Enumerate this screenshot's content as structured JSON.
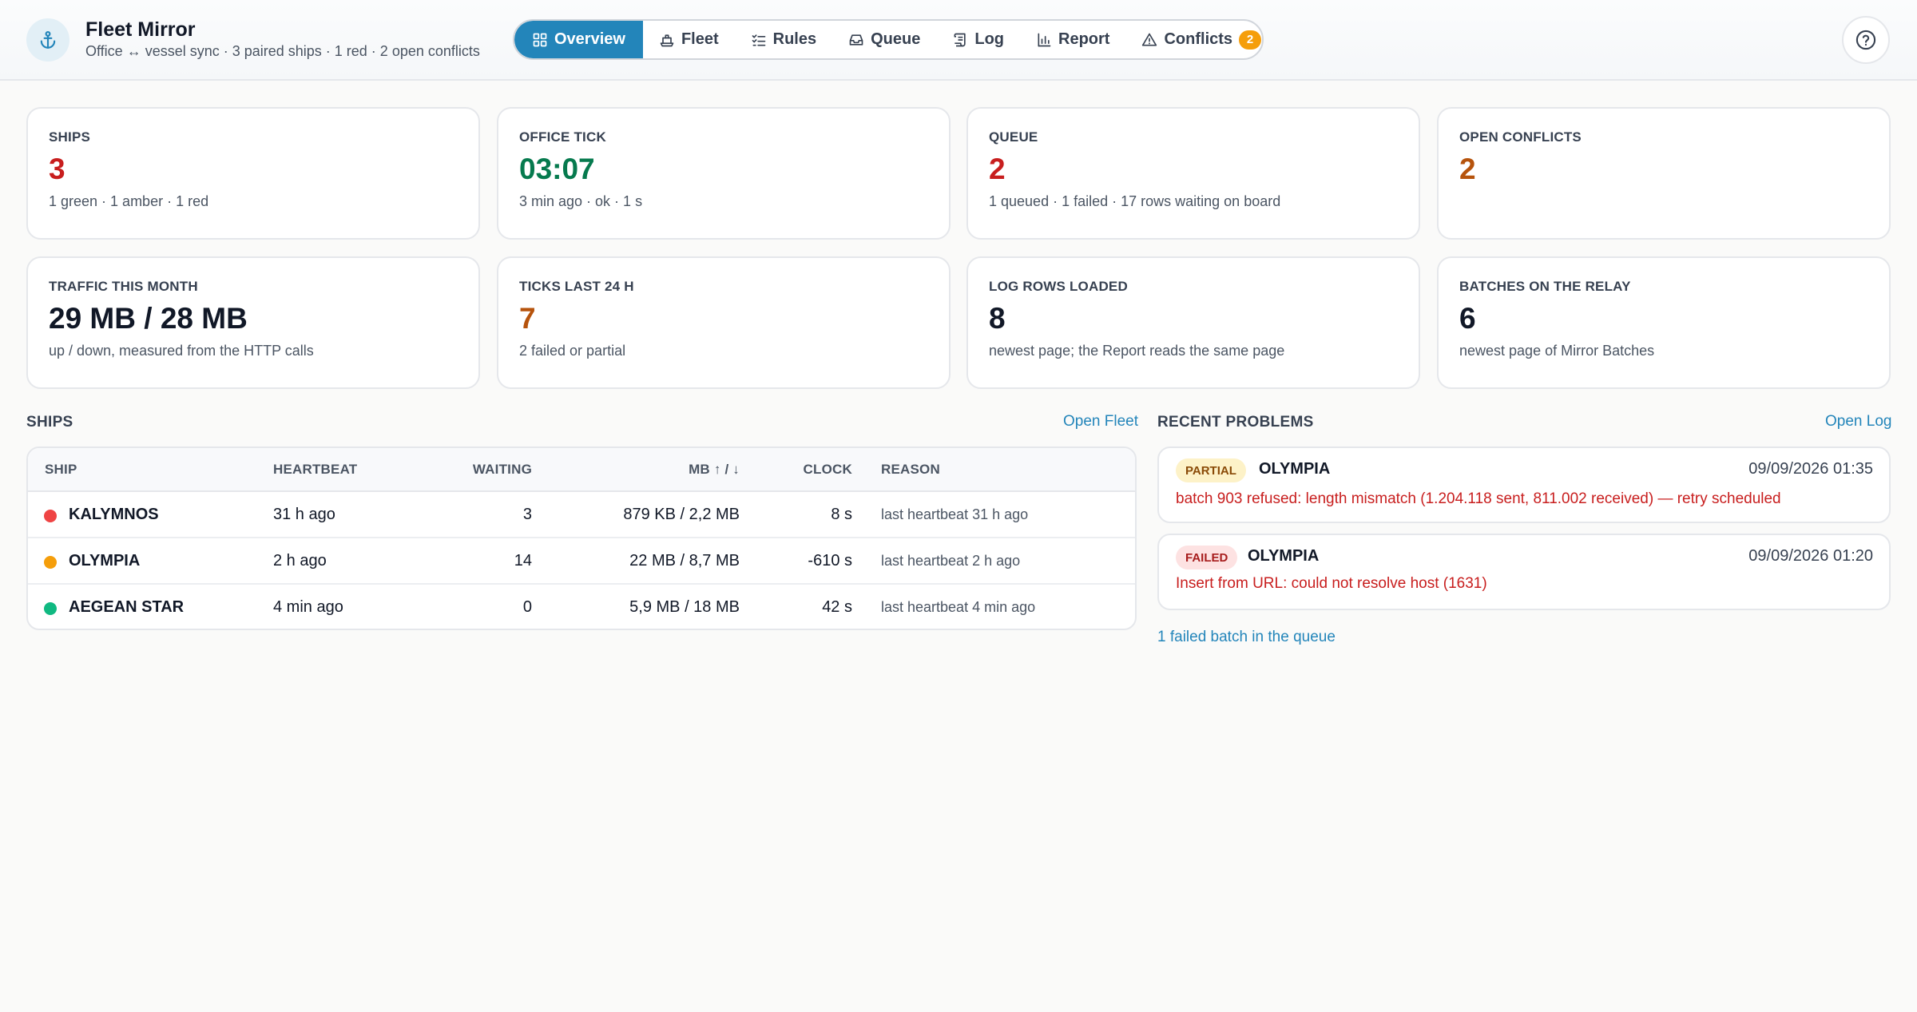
{
  "app": {
    "title": "Fleet Mirror",
    "subtitle": "Office ↔ vessel sync · 3 paired ships · 1 red · 2 open conflicts"
  },
  "tabs": [
    {
      "label": "Overview",
      "icon": "grid-icon",
      "active": true
    },
    {
      "label": "Fleet",
      "icon": "ship-icon"
    },
    {
      "label": "Rules",
      "icon": "checklist-icon"
    },
    {
      "label": "Queue",
      "icon": "inbox-icon"
    },
    {
      "label": "Log",
      "icon": "scroll-icon"
    },
    {
      "label": "Report",
      "icon": "bar-chart-icon"
    },
    {
      "label": "Conflicts",
      "icon": "warning-icon",
      "badge": "2"
    }
  ],
  "colors": {
    "accent": "#2385ba",
    "red": "#c81e1e",
    "green": "#067a4e",
    "orange": "#b6530c",
    "status_green": "#10b981",
    "status_amber": "#f59e0b",
    "status_red": "#ef4444"
  },
  "stats": [
    {
      "label": "SHIPS",
      "value": "3",
      "note": "1 green · 1 amber · 1 red",
      "tone": "red"
    },
    {
      "label": "OFFICE TICK",
      "value": "03:07",
      "note": "3 min ago · ok · 1 s",
      "tone": "green"
    },
    {
      "label": "QUEUE",
      "value": "2",
      "note": "1 queued · 1 failed · 17 rows waiting on board",
      "tone": "red"
    },
    {
      "label": "OPEN CONFLICTS",
      "value": "2",
      "note": "",
      "tone": "orange"
    },
    {
      "label": "TRAFFIC THIS MONTH",
      "value": "29 MB / 28 MB",
      "note": "up / down, measured from the HTTP calls",
      "tone": "dark"
    },
    {
      "label": "TICKS LAST 24 H",
      "value": "7",
      "note": "2 failed or partial",
      "tone": "orange"
    },
    {
      "label": "LOG ROWS LOADED",
      "value": "8",
      "note": "newest page; the Report reads the same page",
      "tone": "dark"
    },
    {
      "label": "BATCHES ON THE RELAY",
      "value": "6",
      "note": "newest page of Mirror Batches",
      "tone": "dark"
    }
  ],
  "ships_section": {
    "title": "SHIPS",
    "link": "Open Fleet",
    "columns": [
      "SHIP",
      "HEARTBEAT",
      "WAITING",
      "MB ↑ / ↓",
      "CLOCK",
      "REASON"
    ],
    "rows": [
      {
        "status": "red",
        "ship": "KALYMNOS",
        "heartbeat": "31 h ago",
        "waiting": "3",
        "mb": "879 KB / 2,2 MB",
        "clock": "8 s",
        "reason": "last heartbeat 31 h ago"
      },
      {
        "status": "amber",
        "ship": "OLYMPIA",
        "heartbeat": "2 h ago",
        "waiting": "14",
        "mb": "22 MB / 8,7 MB",
        "clock": "-610 s",
        "reason": "last heartbeat 2 h ago"
      },
      {
        "status": "green",
        "ship": "AEGEAN STAR",
        "heartbeat": "4 min ago",
        "waiting": "0",
        "mb": "5,9 MB / 18 MB",
        "clock": "42 s",
        "reason": "last heartbeat 4 min ago"
      }
    ]
  },
  "problems_section": {
    "title": "RECENT PROBLEMS",
    "link": "Open Log",
    "items": [
      {
        "kind": "PARTIAL",
        "ship": "OLYMPIA",
        "time": "09/09/2026 01:35",
        "message": "batch 903 refused: length mismatch (1.204.118 sent, 811.002 received) — retry scheduled"
      },
      {
        "kind": "FAILED",
        "ship": "OLYMPIA",
        "time": "09/09/2026 01:20",
        "message": "Insert from URL: could not resolve host (1631)"
      }
    ],
    "footer_link": "1 failed batch in the queue"
  }
}
